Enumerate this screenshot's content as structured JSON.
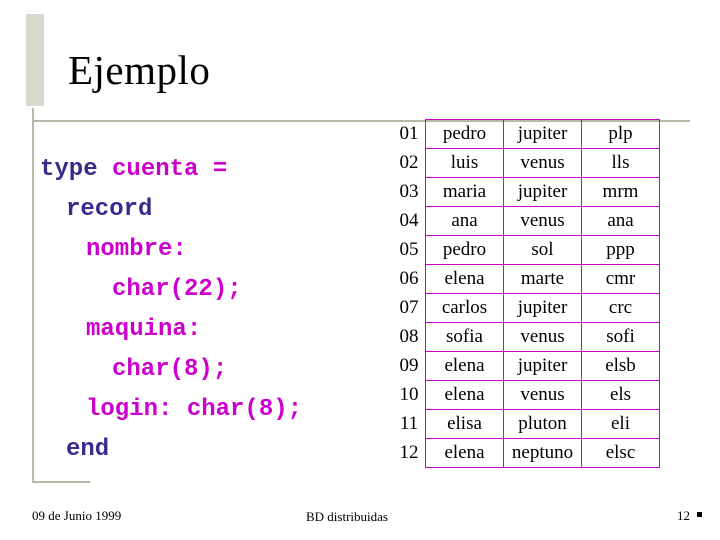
{
  "slide": {
    "title": "Ejemplo",
    "code": {
      "lines": [
        {
          "indent": 0,
          "parts": [
            {
              "t": "type",
              "c": "kw"
            },
            {
              "t": " cuenta =",
              "c": "id"
            }
          ]
        },
        {
          "indent": 1,
          "parts": [
            {
              "t": "record",
              "c": "kw"
            }
          ]
        },
        {
          "indent": 2,
          "parts": [
            {
              "t": "nombre:",
              "c": "id"
            }
          ]
        },
        {
          "indent": 3,
          "parts": [
            {
              "t": "char(22);",
              "c": "id"
            }
          ]
        },
        {
          "indent": 2,
          "parts": [
            {
              "t": "maquina:",
              "c": "id"
            }
          ]
        },
        {
          "indent": 3,
          "parts": [
            {
              "t": "char(8);",
              "c": "id"
            }
          ]
        },
        {
          "indent": 2,
          "parts": [
            {
              "t": "login: char(8);",
              "c": "id"
            }
          ]
        },
        {
          "indent": 1,
          "parts": [
            {
              "t": "end",
              "c": "kw"
            }
          ]
        }
      ]
    },
    "table": {
      "rows": [
        {
          "idx": "01",
          "nombre": "pedro",
          "maquina": "jupiter",
          "login": "plp"
        },
        {
          "idx": "02",
          "nombre": "luis",
          "maquina": "venus",
          "login": "lls"
        },
        {
          "idx": "03",
          "nombre": "maria",
          "maquina": "jupiter",
          "login": "mrm"
        },
        {
          "idx": "04",
          "nombre": "ana",
          "maquina": "venus",
          "login": "ana"
        },
        {
          "idx": "05",
          "nombre": "pedro",
          "maquina": "sol",
          "login": "ppp"
        },
        {
          "idx": "06",
          "nombre": "elena",
          "maquina": "marte",
          "login": "cmr"
        },
        {
          "idx": "07",
          "nombre": "carlos",
          "maquina": "jupiter",
          "login": "crc"
        },
        {
          "idx": "08",
          "nombre": "sofia",
          "maquina": "venus",
          "login": "sofi"
        },
        {
          "idx": "09",
          "nombre": "elena",
          "maquina": "jupiter",
          "login": "elsb"
        },
        {
          "idx": "10",
          "nombre": "elena",
          "maquina": "venus",
          "login": "els"
        },
        {
          "idx": "11",
          "nombre": "elisa",
          "maquina": "pluton",
          "login": "eli"
        },
        {
          "idx": "12",
          "nombre": "elena",
          "maquina": "neptuno",
          "login": "elsc"
        }
      ]
    },
    "footer": {
      "date": "09 de Junio 1999",
      "center": "BD distribuidas",
      "page": "12"
    },
    "colors": {
      "code_magenta": "#cc00cc",
      "code_keyword": "#3a2a8c",
      "table_border": "#cc00cc"
    }
  }
}
